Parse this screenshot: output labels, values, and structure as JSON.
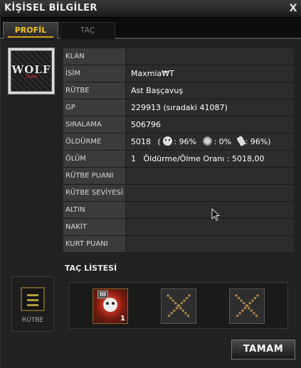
{
  "window": {
    "title": "KİŞİSEL BİLGİLER",
    "close_label": "X"
  },
  "tabs": [
    {
      "label": "PROFİL",
      "active": true
    },
    {
      "label": "TAÇ",
      "active": false
    }
  ],
  "emblem": {
    "logo_text": "WOLF",
    "logo_sub": "TEAM"
  },
  "info": {
    "rows": [
      {
        "label": "KLAN",
        "value": ""
      },
      {
        "label": "İSİM",
        "value": "Maxmia₩T"
      },
      {
        "label": "RÜTBE",
        "value": "Ast Başçavuş"
      },
      {
        "label": "GP",
        "value": "229913 (sıradaki 41087)"
      },
      {
        "label": "SIRALAMA",
        "value": "506796"
      },
      {
        "label": "ÖLDÜRME",
        "value": "5018"
      },
      {
        "label": "ÖLÜM",
        "value": "1   Öldürme/Ölme Oranı : 5018,00"
      },
      {
        "label": "RÜTBE PUANI",
        "value": ""
      },
      {
        "label": "RÜTBE SEVİYESİ",
        "value": ""
      },
      {
        "label": "ALTIN",
        "value": ""
      },
      {
        "label": "NAKİT",
        "value": ""
      },
      {
        "label": "KURT PUANI",
        "value": ""
      }
    ],
    "kill_stats": {
      "skull": ": 96%",
      "grenade": ": 0%",
      "knife": ": 96%)",
      "open_paren": "("
    }
  },
  "crown_list": {
    "title": "TAÇ LİSTESİ",
    "rank_label": "RÜTBE",
    "slots": [
      {
        "badge": "III",
        "count": "1",
        "filled": true
      },
      {
        "filled": false
      },
      {
        "filled": false
      }
    ]
  },
  "buttons": {
    "ok_label": "TAMAM"
  },
  "colors": {
    "active_tab_text": "#f1c31a",
    "accent_gold": "#d4a017",
    "x_mark": "#b58a4a"
  }
}
